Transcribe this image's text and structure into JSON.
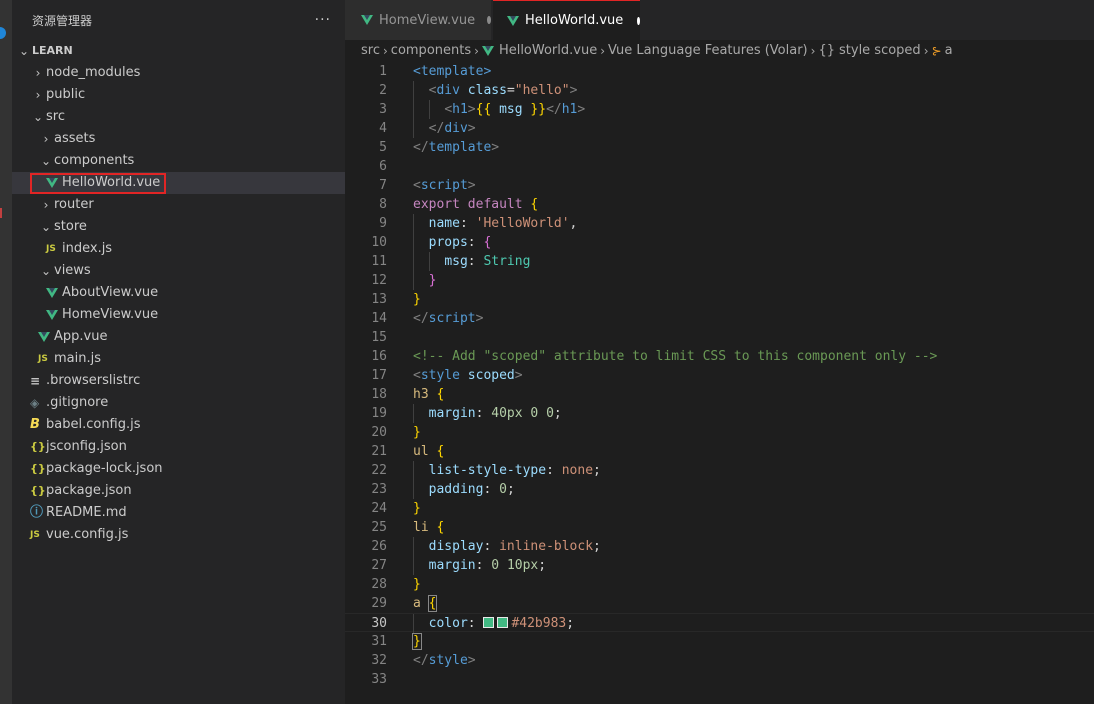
{
  "sidebar": {
    "title": "资源管理器",
    "more": "···",
    "project": "LEARN",
    "items": [
      {
        "label": "node_modules",
        "depth": 1,
        "type": "folder",
        "expanded": false
      },
      {
        "label": "public",
        "depth": 1,
        "type": "folder",
        "expanded": false
      },
      {
        "label": "src",
        "depth": 1,
        "type": "folder",
        "expanded": true
      },
      {
        "label": "assets",
        "depth": 2,
        "type": "folder",
        "expanded": false
      },
      {
        "label": "components",
        "depth": 2,
        "type": "folder",
        "expanded": true
      },
      {
        "label": "HelloWorld.vue",
        "depth": 3,
        "type": "vue",
        "selected": true
      },
      {
        "label": "router",
        "depth": 2,
        "type": "folder",
        "expanded": false
      },
      {
        "label": "store",
        "depth": 2,
        "type": "folder",
        "expanded": true
      },
      {
        "label": "index.js",
        "depth": 3,
        "type": "js"
      },
      {
        "label": "views",
        "depth": 2,
        "type": "folder",
        "expanded": true
      },
      {
        "label": "AboutView.vue",
        "depth": 3,
        "type": "vue"
      },
      {
        "label": "HomeView.vue",
        "depth": 3,
        "type": "vue"
      },
      {
        "label": "App.vue",
        "depth": 2,
        "type": "vue"
      },
      {
        "label": "main.js",
        "depth": 2,
        "type": "js"
      },
      {
        "label": ".browserslistrc",
        "depth": 1,
        "type": "list"
      },
      {
        "label": ".gitignore",
        "depth": 1,
        "type": "git"
      },
      {
        "label": "babel.config.js",
        "depth": 1,
        "type": "babel"
      },
      {
        "label": "jsconfig.json",
        "depth": 1,
        "type": "json"
      },
      {
        "label": "package-lock.json",
        "depth": 1,
        "type": "json"
      },
      {
        "label": "package.json",
        "depth": 1,
        "type": "json"
      },
      {
        "label": "README.md",
        "depth": 1,
        "type": "info"
      },
      {
        "label": "vue.config.js",
        "depth": 1,
        "type": "js"
      }
    ]
  },
  "icons": {
    "js": "JS",
    "json": "{}",
    "babel": "B",
    "list": "≡",
    "git": "◈",
    "info": "ⓘ",
    "chevron_right": "›",
    "chevron_down": "⌄"
  },
  "tabs": [
    {
      "label": "HomeView.vue",
      "active": false,
      "modified": true
    },
    {
      "label": "HelloWorld.vue",
      "active": true,
      "modified": true
    }
  ],
  "breadcrumb": {
    "items": [
      "src",
      "components",
      "HelloWorld.vue",
      "Vue Language Features (Volar)",
      "style scoped",
      "a"
    ],
    "brace_icon": "{}",
    "symbol_icon": "⊱"
  },
  "editor": {
    "current_line": 30,
    "swatch_color": "#42b983",
    "lines": [
      {
        "n": "1",
        "tokens": [
          [
            "tag",
            "<template>"
          ]
        ]
      },
      {
        "n": "2",
        "indent": 1,
        "tokens": [
          [
            "plain",
            "  "
          ],
          [
            "br",
            "<"
          ],
          [
            "tag",
            "div"
          ],
          [
            "plain",
            " "
          ],
          [
            "attr",
            "class"
          ],
          [
            "plain",
            "="
          ],
          [
            "str",
            "\"hello\""
          ],
          [
            "br",
            ">"
          ]
        ]
      },
      {
        "n": "3",
        "indent": 2,
        "tokens": [
          [
            "plain",
            "    "
          ],
          [
            "br",
            "<"
          ],
          [
            "tag",
            "h1"
          ],
          [
            "br",
            ">"
          ],
          [
            "b1",
            "{{"
          ],
          [
            "plain",
            " "
          ],
          [
            "prop",
            "msg"
          ],
          [
            "plain",
            " "
          ],
          [
            "b1",
            "}}"
          ],
          [
            "br",
            "</"
          ],
          [
            "tag",
            "h1"
          ],
          [
            "br",
            ">"
          ]
        ]
      },
      {
        "n": "4",
        "indent": 1,
        "tokens": [
          [
            "plain",
            "  "
          ],
          [
            "br",
            "</"
          ],
          [
            "tag",
            "div"
          ],
          [
            "br",
            ">"
          ]
        ]
      },
      {
        "n": "5",
        "tokens": [
          [
            "br",
            "</"
          ],
          [
            "tag",
            "template"
          ],
          [
            "br",
            ">"
          ]
        ]
      },
      {
        "n": "6",
        "tokens": []
      },
      {
        "n": "7",
        "tokens": [
          [
            "br",
            "<"
          ],
          [
            "tag",
            "script"
          ],
          [
            "br",
            ">"
          ]
        ]
      },
      {
        "n": "8",
        "tokens": [
          [
            "kw",
            "export"
          ],
          [
            "plain",
            " "
          ],
          [
            "kw",
            "default"
          ],
          [
            "plain",
            " "
          ],
          [
            "b1",
            "{"
          ]
        ]
      },
      {
        "n": "9",
        "indent": 1,
        "tokens": [
          [
            "plain",
            "  "
          ],
          [
            "prop",
            "name"
          ],
          [
            "plain",
            ": "
          ],
          [
            "str",
            "'HelloWorld'"
          ],
          [
            "plain",
            ","
          ]
        ]
      },
      {
        "n": "10",
        "indent": 1,
        "tokens": [
          [
            "plain",
            "  "
          ],
          [
            "prop",
            "props"
          ],
          [
            "plain",
            ": "
          ],
          [
            "b2",
            "{"
          ]
        ]
      },
      {
        "n": "11",
        "indent": 2,
        "tokens": [
          [
            "plain",
            "    "
          ],
          [
            "prop",
            "msg"
          ],
          [
            "plain",
            ": "
          ],
          [
            "type",
            "String"
          ]
        ]
      },
      {
        "n": "12",
        "indent": 1,
        "tokens": [
          [
            "plain",
            "  "
          ],
          [
            "b2",
            "}"
          ]
        ]
      },
      {
        "n": "13",
        "tokens": [
          [
            "b1",
            "}"
          ]
        ]
      },
      {
        "n": "14",
        "tokens": [
          [
            "br",
            "</"
          ],
          [
            "tag",
            "script"
          ],
          [
            "br",
            ">"
          ]
        ]
      },
      {
        "n": "15",
        "tokens": []
      },
      {
        "n": "16",
        "tokens": [
          [
            "cmt",
            "<!-- Add \"scoped\" attribute to limit CSS to this component only -->"
          ]
        ]
      },
      {
        "n": "17",
        "tokens": [
          [
            "br",
            "<"
          ],
          [
            "tag",
            "style"
          ],
          [
            "plain",
            " "
          ],
          [
            "attr",
            "scoped"
          ],
          [
            "br",
            ">"
          ]
        ]
      },
      {
        "n": "18",
        "tokens": [
          [
            "sel",
            "h3"
          ],
          [
            "plain",
            " "
          ],
          [
            "b1",
            "{"
          ]
        ]
      },
      {
        "n": "19",
        "indent": 1,
        "tokens": [
          [
            "plain",
            "  "
          ],
          [
            "prop",
            "margin"
          ],
          [
            "plain",
            ": "
          ],
          [
            "num",
            "40px"
          ],
          [
            "plain",
            " "
          ],
          [
            "num",
            "0"
          ],
          [
            "plain",
            " "
          ],
          [
            "num",
            "0"
          ],
          [
            "plain",
            ";"
          ]
        ]
      },
      {
        "n": "20",
        "tokens": [
          [
            "b1",
            "}"
          ]
        ]
      },
      {
        "n": "21",
        "tokens": [
          [
            "sel",
            "ul"
          ],
          [
            "plain",
            " "
          ],
          [
            "b1",
            "{"
          ]
        ]
      },
      {
        "n": "22",
        "indent": 1,
        "tokens": [
          [
            "plain",
            "  "
          ],
          [
            "prop",
            "list-style-type"
          ],
          [
            "plain",
            ": "
          ],
          [
            "str",
            "none"
          ],
          [
            "plain",
            ";"
          ]
        ]
      },
      {
        "n": "23",
        "indent": 1,
        "tokens": [
          [
            "plain",
            "  "
          ],
          [
            "prop",
            "padding"
          ],
          [
            "plain",
            ": "
          ],
          [
            "num",
            "0"
          ],
          [
            "plain",
            ";"
          ]
        ]
      },
      {
        "n": "24",
        "tokens": [
          [
            "b1",
            "}"
          ]
        ]
      },
      {
        "n": "25",
        "tokens": [
          [
            "sel",
            "li"
          ],
          [
            "plain",
            " "
          ],
          [
            "b1",
            "{"
          ]
        ]
      },
      {
        "n": "26",
        "indent": 1,
        "tokens": [
          [
            "plain",
            "  "
          ],
          [
            "prop",
            "display"
          ],
          [
            "plain",
            ": "
          ],
          [
            "str",
            "inline-block"
          ],
          [
            "plain",
            ";"
          ]
        ]
      },
      {
        "n": "27",
        "indent": 1,
        "tokens": [
          [
            "plain",
            "  "
          ],
          [
            "prop",
            "margin"
          ],
          [
            "plain",
            ": "
          ],
          [
            "num",
            "0"
          ],
          [
            "plain",
            " "
          ],
          [
            "num",
            "10px"
          ],
          [
            "plain",
            ";"
          ]
        ]
      },
      {
        "n": "28",
        "tokens": [
          [
            "b1",
            "}"
          ]
        ]
      },
      {
        "n": "29",
        "tokens": [
          [
            "sel",
            "a"
          ],
          [
            "plain",
            " "
          ],
          [
            "b1 bmatch",
            "{"
          ]
        ]
      },
      {
        "n": "30",
        "indent": 1,
        "swatch": true,
        "tokens": [
          [
            "plain",
            "  "
          ],
          [
            "prop",
            "color"
          ],
          [
            "plain",
            ": "
          ],
          [
            "swatch",
            ""
          ],
          [
            "swatch",
            ""
          ],
          [
            "str",
            "#42b983"
          ],
          [
            "plain",
            ";"
          ]
        ]
      },
      {
        "n": "31",
        "tokens": [
          [
            "b1 bmatch",
            "}"
          ]
        ]
      },
      {
        "n": "32",
        "tokens": [
          [
            "br",
            "</"
          ],
          [
            "tag",
            "style"
          ],
          [
            "br",
            ">"
          ]
        ]
      },
      {
        "n": "33",
        "tokens": []
      }
    ]
  }
}
